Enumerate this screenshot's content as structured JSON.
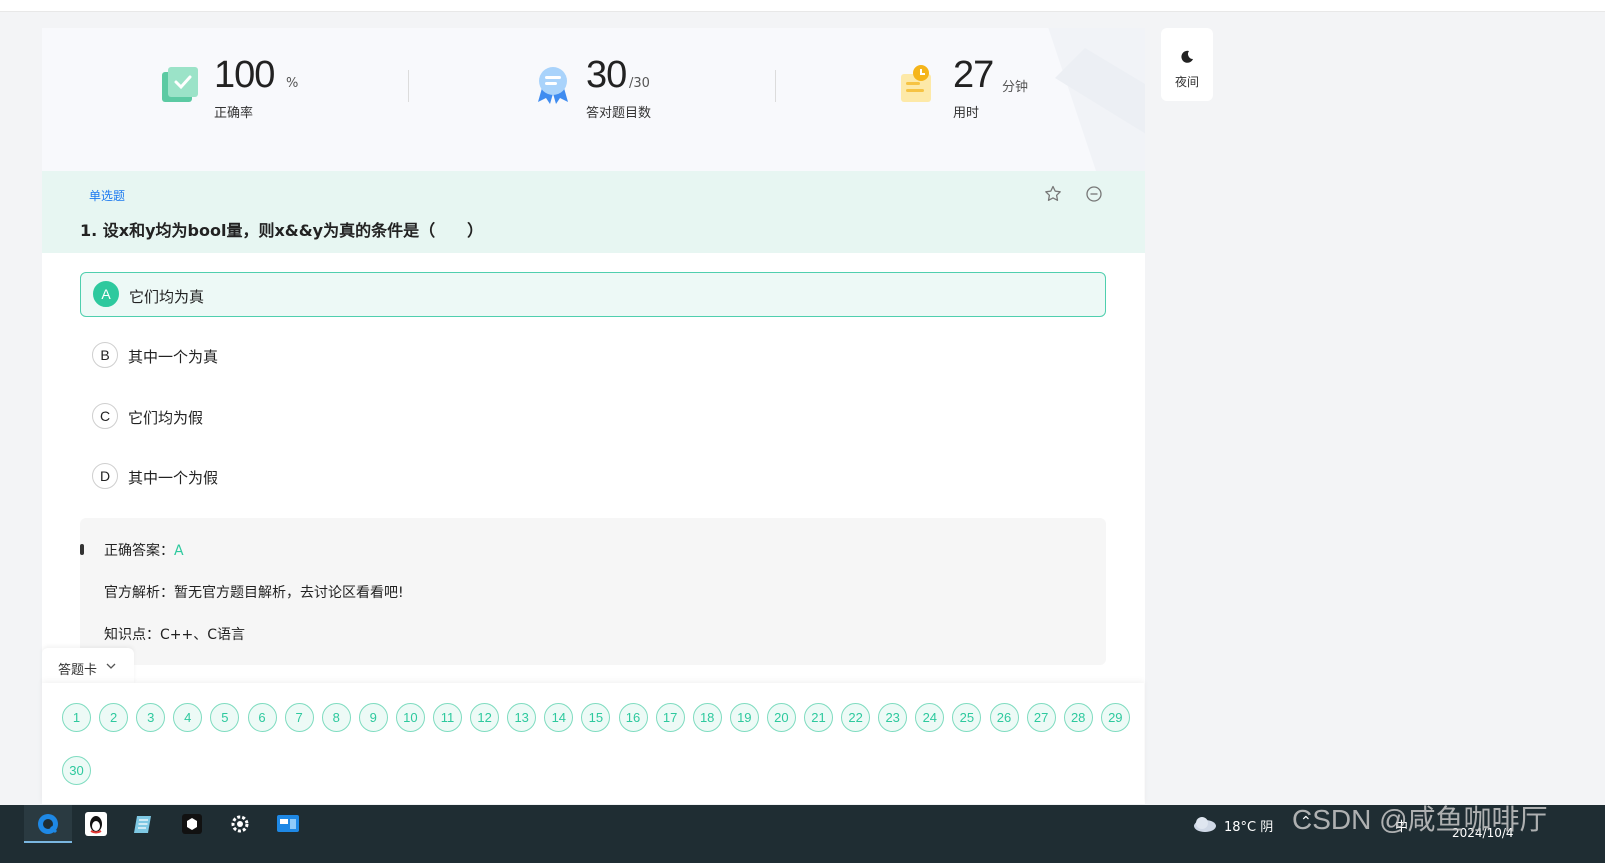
{
  "stats": {
    "accuracy": {
      "value": "100",
      "unit": "%",
      "label": "正确率"
    },
    "correct": {
      "value": "30",
      "unit": "/30",
      "label": "答对题目数"
    },
    "time": {
      "value": "27",
      "unit": "分钟",
      "label": "用时"
    }
  },
  "night_mode": {
    "label": "夜间"
  },
  "question": {
    "type": "单选题",
    "title": "1. 设x和y均为bool量，则x&&y为真的条件是（　　）",
    "options": [
      {
        "letter": "A",
        "text": "它们均为真",
        "selected": true
      },
      {
        "letter": "B",
        "text": "其中一个为真",
        "selected": false
      },
      {
        "letter": "C",
        "text": "它们均为假",
        "selected": false
      },
      {
        "letter": "D",
        "text": "其中一个为假",
        "selected": false
      }
    ]
  },
  "answer": {
    "correct_label": "正确答案：",
    "correct_value": "A",
    "analysis": "官方解析：暂无官方题目解析，去讨论区看看吧!",
    "knowledge": "知识点：C++、C语言"
  },
  "answer_sheet": {
    "tab_label": "答题卡",
    "numbers": [
      "1",
      "2",
      "3",
      "4",
      "5",
      "6",
      "7",
      "8",
      "9",
      "10",
      "11",
      "12",
      "13",
      "14",
      "15",
      "16",
      "17",
      "18",
      "19",
      "20",
      "21",
      "22",
      "23",
      "24",
      "25",
      "26",
      "27",
      "28",
      "29",
      "30"
    ]
  },
  "taskbar": {
    "weather": "18°C  阴",
    "ime": "中",
    "date": "2024/10/4"
  },
  "watermark": "CSDN @咸鱼咖啡厅",
  "colors": {
    "accent": "#2ec99e",
    "link": "#1d7af0",
    "question_bg": "#e7f6f2"
  }
}
